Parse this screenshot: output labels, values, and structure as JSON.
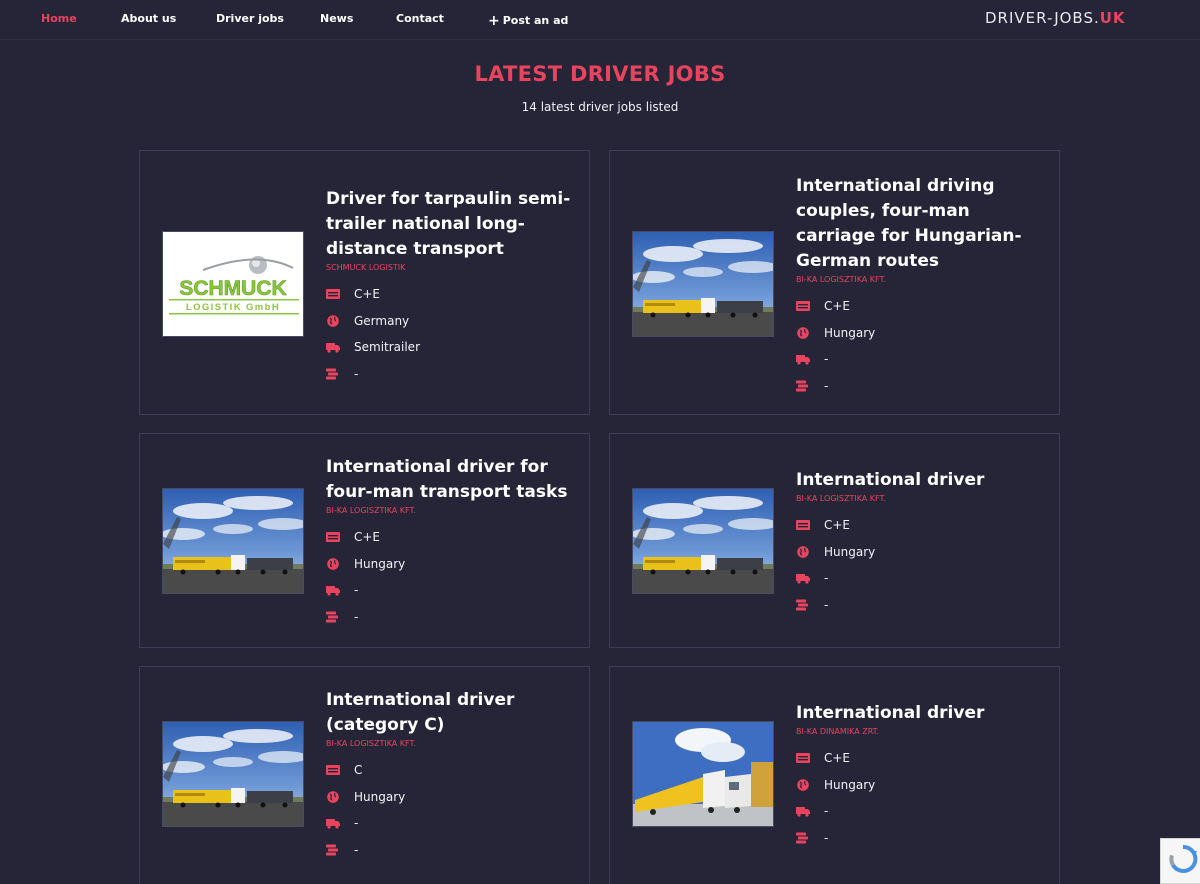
{
  "nav": {
    "items": [
      {
        "label": "Home",
        "active": true
      },
      {
        "label": "About us",
        "active": false
      },
      {
        "label": "Driver jobs",
        "active": false
      },
      {
        "label": "News",
        "active": false
      },
      {
        "label": "Contact",
        "active": false
      }
    ],
    "post_ad": "Post an ad",
    "brand_main": "DRIVER-JOBS.",
    "brand_tld": "UK"
  },
  "header": {
    "title": "LATEST DRIVER JOBS",
    "subtitle": "14 latest driver jobs listed"
  },
  "logo_text": {
    "line1": "SCHMUCK",
    "line2": "LOGISTIK GmbH"
  },
  "colors": {
    "accent": "#e8445e",
    "background": "#262538",
    "card_border": "#3e3d55"
  },
  "jobs": [
    {
      "title": "Driver for tarpaulin semi-trailer national long-distance transport",
      "company": "SCHMUCK LOGISTIK",
      "license": "C+E",
      "country": "Germany",
      "vehicle": "Semitrailer",
      "salary": "-",
      "image": "schmuck-logo"
    },
    {
      "title": "International driving couples, four-man carriage for Hungarian-German routes",
      "company": "BI-KA LOGISZTIKA KFT.",
      "license": "C+E",
      "country": "Hungary",
      "vehicle": "-",
      "salary": "-",
      "image": "truck-photo"
    },
    {
      "title": "International driver for four-man transport tasks",
      "company": "BI-KA LOGISZTIKA KFT.",
      "license": "C+E",
      "country": "Hungary",
      "vehicle": "-",
      "salary": "-",
      "image": "truck-photo"
    },
    {
      "title": "International driver",
      "company": "BI-KA LOGISZTIKA KFT.",
      "license": "C+E",
      "country": "Hungary",
      "vehicle": "-",
      "salary": "-",
      "image": "truck-photo"
    },
    {
      "title": "International driver (category C)",
      "company": "BI-KA LOGISZTIKA KFT.",
      "license": "C",
      "country": "Hungary",
      "vehicle": "-",
      "salary": "-",
      "image": "truck-photo"
    },
    {
      "title": "International driver",
      "company": "BI-KA DINAMIKA ZRT.",
      "license": "C+E",
      "country": "Hungary",
      "vehicle": "-",
      "salary": "-",
      "image": "fleet-photo"
    }
  ],
  "icons": {
    "license": "license-card-icon",
    "country": "globe-icon",
    "vehicle": "truck-icon",
    "salary": "money-stack-icon"
  }
}
